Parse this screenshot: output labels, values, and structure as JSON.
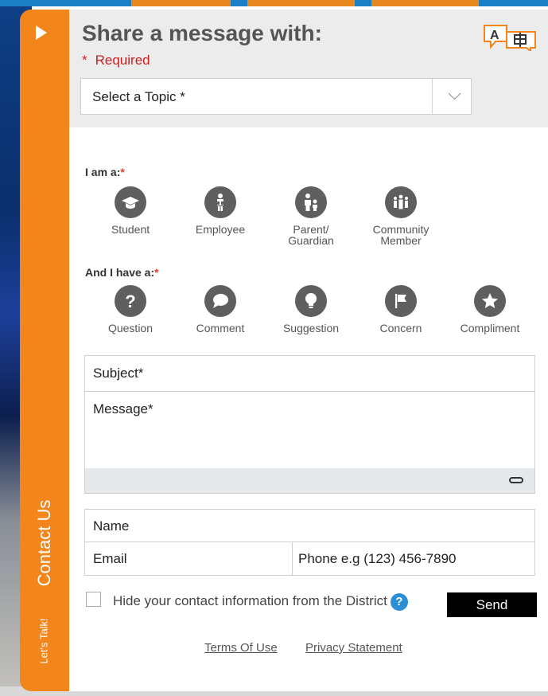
{
  "colors": {
    "tab_orange": "#f2851c",
    "required_red": "#cc1f1f",
    "icon_gray": "#5f5f5f",
    "send_black": "#000000"
  },
  "tab": {
    "contact_label": "Contact Us",
    "lets_talk_label": "Let's Talk!"
  },
  "header": {
    "title": "Share a message with:",
    "required_marker": "*",
    "required_label": "Required",
    "topic_placeholder": "Select a Topic *"
  },
  "role_section": {
    "label": "I am a:",
    "marker": "*",
    "options": [
      {
        "label": "Student",
        "icon": "graduation-cap-icon"
      },
      {
        "label": "Employee",
        "icon": "employee-icon"
      },
      {
        "label": "Parent/\nGuardian",
        "icon": "parent-guardian-icon"
      },
      {
        "label": "Community\nMember",
        "icon": "community-icon"
      }
    ]
  },
  "type_section": {
    "label": "And I have a:",
    "marker": "*",
    "options": [
      {
        "label": "Question",
        "icon": "question-icon"
      },
      {
        "label": "Comment",
        "icon": "comment-icon"
      },
      {
        "label": "Suggestion",
        "icon": "lightbulb-icon"
      },
      {
        "label": "Concern",
        "icon": "flag-icon"
      },
      {
        "label": "Compliment",
        "icon": "star-icon"
      }
    ]
  },
  "form": {
    "subject_placeholder": "Subject*",
    "message_placeholder": "Message*",
    "name_placeholder": "Name",
    "email_placeholder": "Email",
    "phone_placeholder": "Phone e.g (123) 456-7890",
    "hide_label": "Hide your contact information from the District",
    "help_glyph": "?",
    "send_label": "Send"
  },
  "footer": {
    "terms_label": "Terms Of Use",
    "privacy_label": "Privacy Statement"
  }
}
